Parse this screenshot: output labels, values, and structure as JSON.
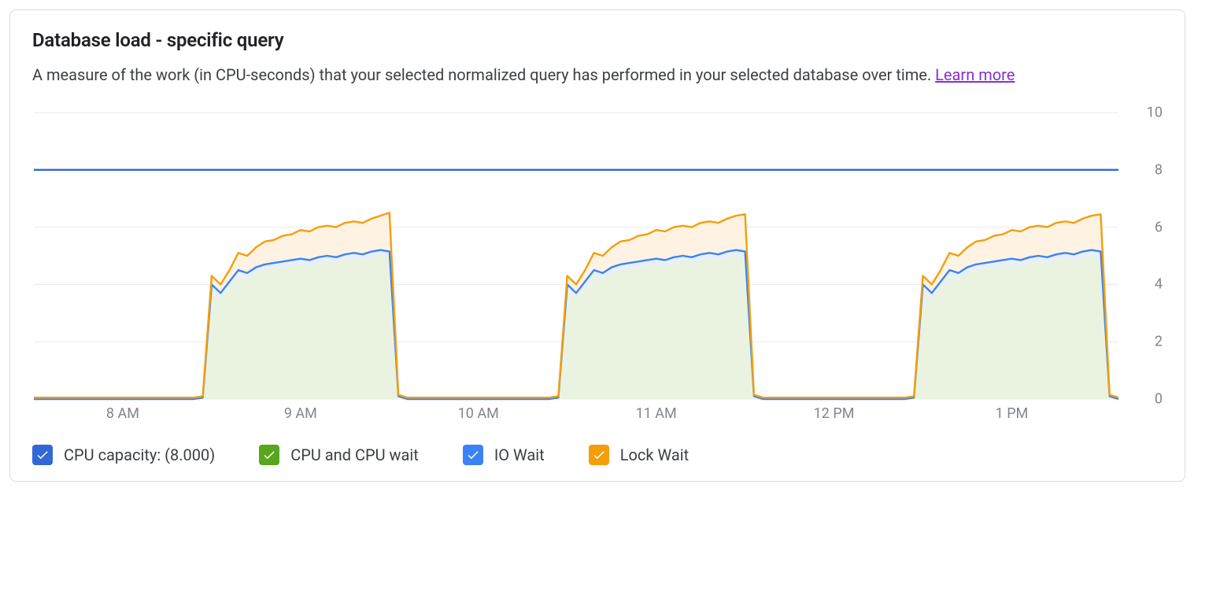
{
  "header": {
    "title": "Database load - specific query",
    "subtitle_prefix": "A measure of the work (in CPU-seconds) that your selected normalized query has performed in your selected database over time. ",
    "learn_more": "Learn more"
  },
  "legend": {
    "cpu_capacity": "CPU capacity: (8.000)",
    "cpu_wait": "CPU and CPU wait",
    "io_wait": "IO Wait",
    "lock_wait": "Lock Wait"
  },
  "colors": {
    "cpu_capacity": "#3367d6",
    "cpu_wait_box": "#57a61c",
    "cpu_wait_fill": "#eaf3e0",
    "io_wait": "#3b82f6",
    "io_wait_fill": "#e8f0fe",
    "lock_wait": "#f59e0b",
    "lock_wait_fill": "#fef3e3",
    "grid": "#e8eaed",
    "axis_text": "#80868b"
  },
  "chart_data": {
    "type": "area",
    "title": "Database load - specific query",
    "xlabel": "",
    "ylabel": "",
    "ylim": [
      0,
      10
    ],
    "x_ticks": [
      "8 AM",
      "9 AM",
      "10 AM",
      "11 AM",
      "12 PM",
      "1 PM"
    ],
    "y_ticks": [
      0,
      2,
      4,
      6,
      8,
      10
    ],
    "cpu_capacity_line": 8.0,
    "x": [
      7.5,
      7.6,
      7.7,
      7.8,
      7.9,
      8.0,
      8.1,
      8.2,
      8.3,
      8.4,
      8.45,
      8.5,
      8.55,
      8.6,
      8.65,
      8.7,
      8.75,
      8.8,
      8.85,
      8.9,
      8.95,
      9.0,
      9.05,
      9.1,
      9.15,
      9.2,
      9.25,
      9.3,
      9.35,
      9.4,
      9.45,
      9.5,
      9.55,
      9.6,
      9.7,
      9.8,
      9.9,
      10.0,
      10.1,
      10.2,
      10.3,
      10.4,
      10.45,
      10.5,
      10.55,
      10.6,
      10.65,
      10.7,
      10.75,
      10.8,
      10.85,
      10.9,
      10.95,
      11.0,
      11.05,
      11.1,
      11.15,
      11.2,
      11.25,
      11.3,
      11.35,
      11.4,
      11.45,
      11.5,
      11.55,
      11.6,
      11.7,
      11.8,
      11.9,
      12.0,
      12.1,
      12.2,
      12.3,
      12.4,
      12.45,
      12.5,
      12.55,
      12.6,
      12.65,
      12.7,
      12.75,
      12.8,
      12.85,
      12.9,
      12.95,
      13.0,
      13.05,
      13.1,
      13.15,
      13.2,
      13.25,
      13.3,
      13.35,
      13.4,
      13.45,
      13.5,
      13.55,
      13.6
    ],
    "series": [
      {
        "name": "CPU and CPU wait",
        "color": "#57a61c",
        "values": [
          0,
          0,
          0,
          0,
          0,
          0,
          0,
          0,
          0,
          0,
          0.05,
          3.8,
          3.5,
          3.9,
          4.3,
          4.2,
          4.4,
          4.5,
          4.55,
          4.6,
          4.65,
          4.7,
          4.65,
          4.75,
          4.8,
          4.75,
          4.85,
          4.9,
          4.85,
          4.95,
          5.0,
          4.95,
          0.1,
          0,
          0,
          0,
          0,
          0,
          0,
          0,
          0,
          0,
          0.05,
          3.8,
          3.5,
          3.9,
          4.3,
          4.2,
          4.4,
          4.5,
          4.55,
          4.6,
          4.65,
          4.7,
          4.65,
          4.75,
          4.8,
          4.75,
          4.85,
          4.9,
          4.85,
          4.95,
          5.0,
          4.95,
          0.1,
          0,
          0,
          0,
          0,
          0,
          0,
          0,
          0,
          0,
          0.05,
          3.8,
          3.5,
          3.9,
          4.3,
          4.2,
          4.4,
          4.5,
          4.55,
          4.6,
          4.65,
          4.7,
          4.65,
          4.75,
          4.8,
          4.75,
          4.85,
          4.9,
          4.85,
          4.95,
          5.0,
          4.95,
          0.1,
          0
        ]
      },
      {
        "name": "IO Wait",
        "color": "#3b82f6",
        "values": [
          0,
          0,
          0,
          0,
          0,
          0,
          0,
          0,
          0,
          0,
          0.05,
          4.0,
          3.7,
          4.1,
          4.5,
          4.4,
          4.6,
          4.7,
          4.75,
          4.8,
          4.85,
          4.9,
          4.85,
          4.95,
          5.0,
          4.95,
          5.05,
          5.1,
          5.05,
          5.15,
          5.2,
          5.15,
          0.1,
          0,
          0,
          0,
          0,
          0,
          0,
          0,
          0,
          0,
          0.05,
          4.0,
          3.7,
          4.1,
          4.5,
          4.4,
          4.6,
          4.7,
          4.75,
          4.8,
          4.85,
          4.9,
          4.85,
          4.95,
          5.0,
          4.95,
          5.05,
          5.1,
          5.05,
          5.15,
          5.2,
          5.15,
          0.1,
          0,
          0,
          0,
          0,
          0,
          0,
          0,
          0,
          0,
          0.05,
          4.0,
          3.7,
          4.1,
          4.5,
          4.4,
          4.6,
          4.7,
          4.75,
          4.8,
          4.85,
          4.9,
          4.85,
          4.95,
          5.0,
          4.95,
          5.05,
          5.1,
          5.05,
          5.15,
          5.2,
          5.15,
          0.1,
          0
        ]
      },
      {
        "name": "Lock Wait",
        "color": "#f59e0b",
        "values": [
          0.05,
          0.05,
          0.05,
          0.05,
          0.05,
          0.05,
          0.05,
          0.05,
          0.05,
          0.05,
          0.1,
          4.3,
          4.0,
          4.5,
          5.1,
          5.0,
          5.3,
          5.5,
          5.55,
          5.7,
          5.75,
          5.9,
          5.85,
          6.0,
          6.05,
          6.0,
          6.15,
          6.2,
          6.15,
          6.3,
          6.4,
          6.5,
          0.15,
          0.05,
          0.05,
          0.05,
          0.05,
          0.05,
          0.05,
          0.05,
          0.05,
          0.05,
          0.1,
          4.3,
          4.0,
          4.5,
          5.1,
          5.0,
          5.3,
          5.5,
          5.55,
          5.7,
          5.75,
          5.9,
          5.85,
          6.0,
          6.05,
          6.0,
          6.15,
          6.2,
          6.15,
          6.3,
          6.4,
          6.45,
          0.15,
          0.05,
          0.05,
          0.05,
          0.05,
          0.05,
          0.05,
          0.05,
          0.05,
          0.05,
          0.1,
          4.3,
          4.0,
          4.5,
          5.1,
          5.0,
          5.3,
          5.5,
          5.55,
          5.7,
          5.75,
          5.9,
          5.85,
          6.0,
          6.05,
          6.0,
          6.15,
          6.2,
          6.15,
          6.3,
          6.4,
          6.45,
          0.15,
          0.05
        ]
      }
    ]
  }
}
